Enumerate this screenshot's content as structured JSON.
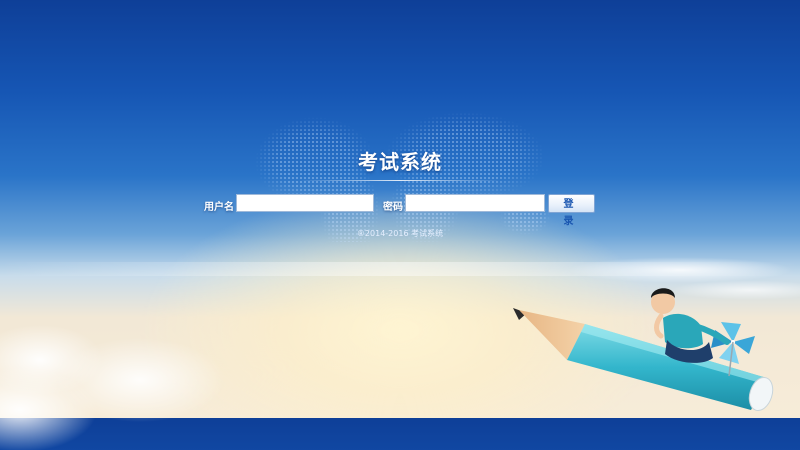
{
  "page": {
    "title": "考试系统",
    "copyright": "®2014-2016 考试系统"
  },
  "login_form": {
    "username_label": "用户名",
    "username_value": "",
    "password_label": "密码",
    "password_value": "",
    "submit_label": "登 录"
  },
  "colors": {
    "sky_top": "#0e3f98",
    "sky_mid": "#2a74c8",
    "horizon": "#f7ecd8",
    "button_text": "#1a56b0"
  },
  "icons": {
    "world_map": "world-map-graphic",
    "mascot": "pencil-rider-illustration"
  }
}
